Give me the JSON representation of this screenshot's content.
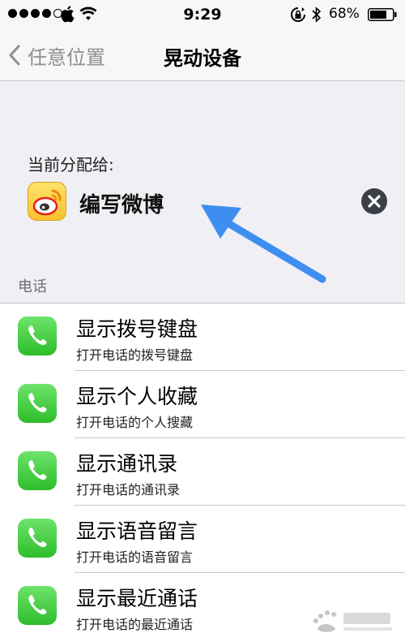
{
  "status_bar": {
    "time": "9:29",
    "battery_percent": "68%"
  },
  "nav": {
    "back_label": "任意位置",
    "title": "晃动设备"
  },
  "assigned": {
    "header": "当前分配给:",
    "app_label": "编写微博",
    "app_icon": "weibo-icon",
    "clear_icon": "clear-circle-icon"
  },
  "section": {
    "header": "电话"
  },
  "items": [
    {
      "title": "显示拨号键盘",
      "subtitle": "打开电话的拨号键盘",
      "icon": "phone-icon"
    },
    {
      "title": "显示个人收藏",
      "subtitle": "打开电话的个人搜藏",
      "icon": "phone-icon"
    },
    {
      "title": "显示通讯录",
      "subtitle": "打开电话的通讯录",
      "icon": "phone-icon"
    },
    {
      "title": "显示语音留言",
      "subtitle": "打开电话的语音留言",
      "icon": "phone-icon"
    },
    {
      "title": "显示最近通话",
      "subtitle": "打开电话的最近通话",
      "icon": "phone-icon"
    }
  ],
  "colors": {
    "accent_arrow": "#3d8ef0",
    "phone_green": "#2dbd2a",
    "weibo_yellow": "#fbc02d"
  }
}
